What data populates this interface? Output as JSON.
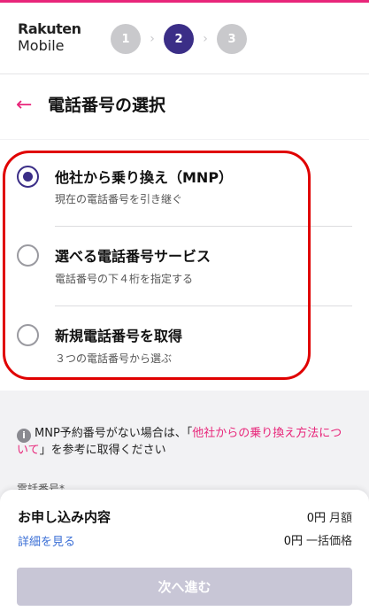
{
  "header": {
    "logo_line1": "Rakuten",
    "logo_line2": "Mobile",
    "steps": [
      "1",
      "2",
      "3"
    ],
    "active_step": 2
  },
  "titlebar": {
    "back_icon": "back-arrow-icon",
    "title": "電話番号の選択"
  },
  "options": [
    {
      "title": "他社から乗り換え（MNP）",
      "subtitle": "現在の電話番号を引き継ぐ",
      "selected": true
    },
    {
      "title": "選べる電話番号サービス",
      "subtitle": "電話番号の下４桁を指定する",
      "selected": false
    },
    {
      "title": "新規電話番号を取得",
      "subtitle": "３つの電話番号から選ぶ",
      "selected": false
    }
  ],
  "info": {
    "icon": "info-icon",
    "text_before": "MNP予約番号がない場合は、「",
    "link": "他社からの乗り換え方法について",
    "text_after": "」を参考に取得ください"
  },
  "partial_label": "電話番号*",
  "summary": {
    "title": "お申し込み内容",
    "details_link": "詳細を見る",
    "monthly_price": "0円",
    "monthly_unit": "月額",
    "onetime_price": "0円",
    "onetime_unit": "一括価格"
  },
  "next_button": "次へ進む",
  "colors": {
    "accent": "#e8267a",
    "primary": "#3b2e87",
    "highlight_frame": "#e00000",
    "disabled_button": "#c8c6d6"
  }
}
